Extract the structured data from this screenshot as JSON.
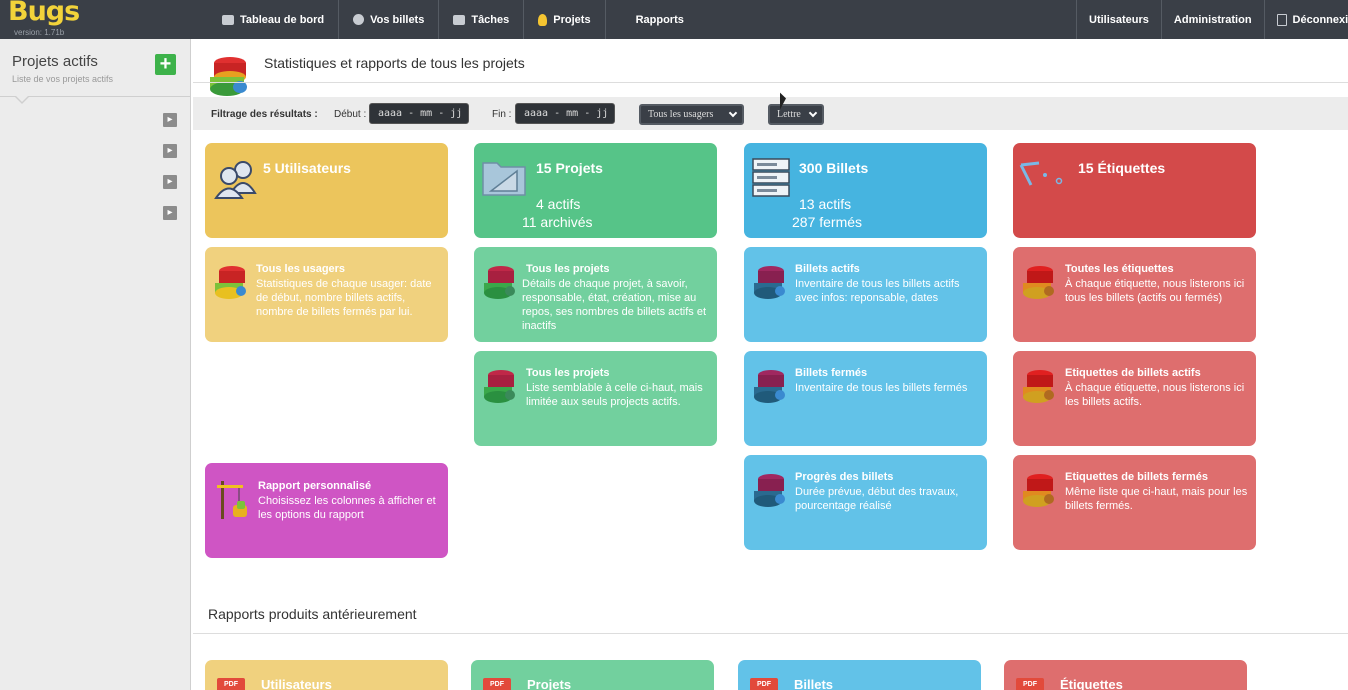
{
  "app": {
    "logo": "Bugs",
    "version": "version: 1.71b"
  },
  "nav_left": [
    "Tableau de bord",
    "Vos billets",
    "Tâches",
    "Projets",
    "Rapports"
  ],
  "nav_right": [
    "Utilisateurs",
    "Administration",
    "Déconnexion"
  ],
  "sidebar": {
    "title": "Projets actifs",
    "subtitle": "Liste de vos projets actifs",
    "add_label": "+"
  },
  "main": {
    "title": "Statistiques et rapports de tous les projets"
  },
  "filter": {
    "label": "Filtrage des résultats :",
    "start_label": "Début :",
    "start_placeholder": "aaaa - mm - jj",
    "end_label": "Fin :",
    "end_placeholder": "aaaa - mm - jj",
    "users_select": "Tous les usagers",
    "format_select": "Lettre"
  },
  "summary": {
    "users": {
      "title": "5 Utilisateurs"
    },
    "projects": {
      "title": "15 Projets",
      "line1": "4 actifs",
      "line2": "11 archivés"
    },
    "tickets": {
      "title": "300 Billets",
      "line1": "13 actifs",
      "line2": "287 fermés"
    },
    "tags": {
      "title": "15 Étiquettes"
    }
  },
  "reports": {
    "users_all": {
      "title": "Tous les usagers",
      "desc": "Statistiques de chaque usager: date de début, nombre billets actifs, nombre de billets fermés par lui."
    },
    "projects_all": {
      "title": "Tous les projets",
      "desc": "Détails de chaque projet, à savoir, responsable, état, création, mise au repos, ses nombres de billets actifs et inactifs"
    },
    "projects_active": {
      "title": "Tous les projets",
      "desc": "Liste semblable à celle ci-haut, mais limitée aux seuls projects actifs."
    },
    "tickets_active": {
      "title": "Billets actifs",
      "desc": "Inventaire de tous les billets actifs avec infos: reponsable, dates"
    },
    "tickets_closed": {
      "title": "Billets fermés",
      "desc": "Inventaire de tous les billets fermés"
    },
    "tickets_progress": {
      "title": "Progrès des billets",
      "desc": "Durée prévue, début des travaux, pourcentage réalisé"
    },
    "tags_all": {
      "title": "Toutes les étiquettes",
      "desc": "À chaque étiquette, nous listerons ici tous les billets (actifs ou fermés)"
    },
    "tags_active": {
      "title": "Etiquettes de billets actifs",
      "desc": "À chaque étiquette, nous listerons ici les billets actifs."
    },
    "tags_closed": {
      "title": "Etiquettes de billets fermés",
      "desc": "Même liste que ci-haut, mais pour les billets fermés."
    },
    "custom": {
      "title": "Rapport personnalisé",
      "desc": "Choisissez les colonnes à afficher et les options du rapport"
    }
  },
  "previous": {
    "title": "Rapports produits antérieurement",
    "pdf_badge": "PDF",
    "items": [
      "Utilisateurs",
      "Projets",
      "Billets",
      "Étiquettes"
    ]
  }
}
